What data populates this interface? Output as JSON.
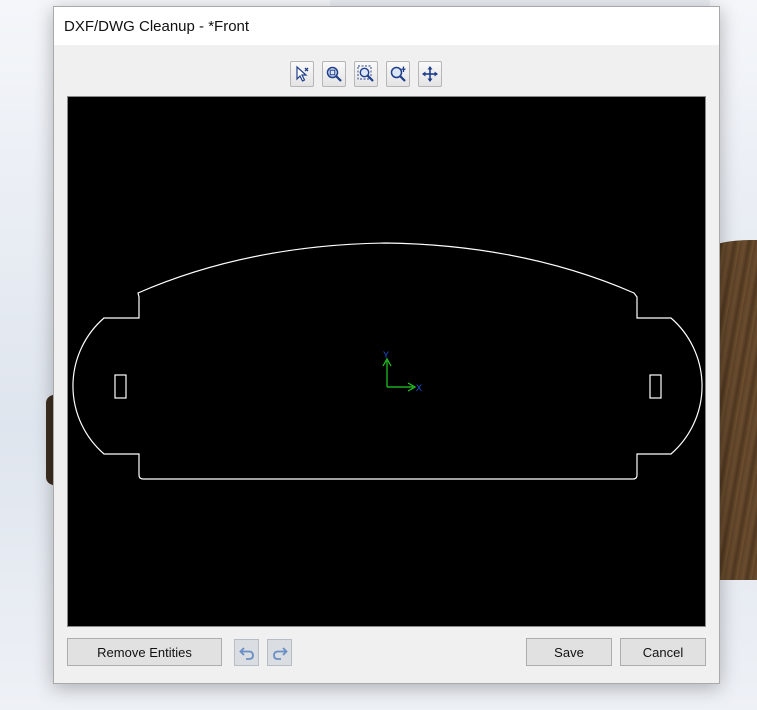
{
  "dialog": {
    "title": "DXF/DWG Cleanup - *Front"
  },
  "toolbar": {
    "buttons": [
      {
        "name": "select-icon"
      },
      {
        "name": "zoom-to-fit-icon"
      },
      {
        "name": "zoom-to-area-icon"
      },
      {
        "name": "zoom-in-out-icon"
      },
      {
        "name": "pan-icon"
      }
    ]
  },
  "triad": {
    "x_label": "X",
    "y_label": "Y"
  },
  "footer": {
    "remove_entities_label": "Remove Entities",
    "undo_icon": "undo-icon",
    "redo_icon": "redo-icon",
    "save_label": "Save",
    "cancel_label": "Cancel"
  },
  "colors": {
    "canvas_bg": "#000000",
    "geometry": "#ffffff",
    "triad_y": "#22cc22",
    "triad_x": "#2255dd"
  }
}
